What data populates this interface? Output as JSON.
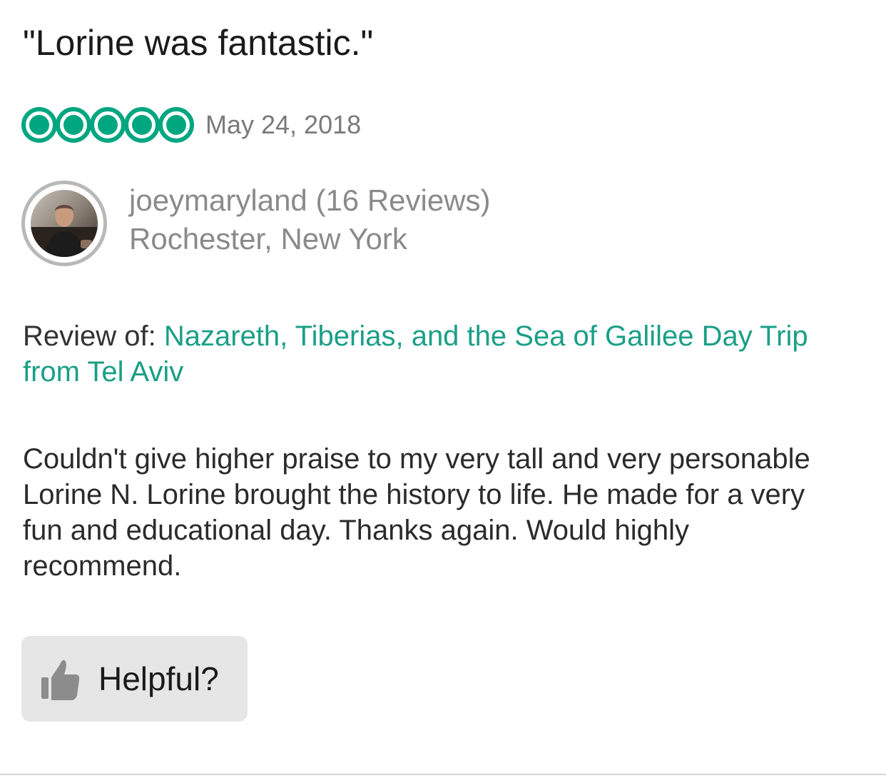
{
  "review": {
    "title": "\"Lorine was fantastic.\"",
    "rating": 5,
    "rating_max": 5,
    "date": "May 24, 2018",
    "reviewer": {
      "name_line": "joeymaryland (16 Reviews)",
      "location": "Rochester, New York"
    },
    "review_of": {
      "label": "Review of:",
      "link_text": "Nazareth, Tiberias, and the Sea of Galilee Day Trip from Tel Aviv"
    },
    "body": "Couldn't give higher praise to my very tall and very personable Lorine N. Lorine brought the history to life. He made for a very fun and educational day. Thanks again. Would highly recommend.",
    "helpful_label": "Helpful?"
  },
  "icons": {
    "rating": "bubble-rating-icon",
    "helpful": "thumbs-up-icon"
  },
  "colors": {
    "accent": "#00a680",
    "link": "#1a9f86",
    "button_bg": "#e6e6e6",
    "muted_text": "#8a8a8a"
  }
}
